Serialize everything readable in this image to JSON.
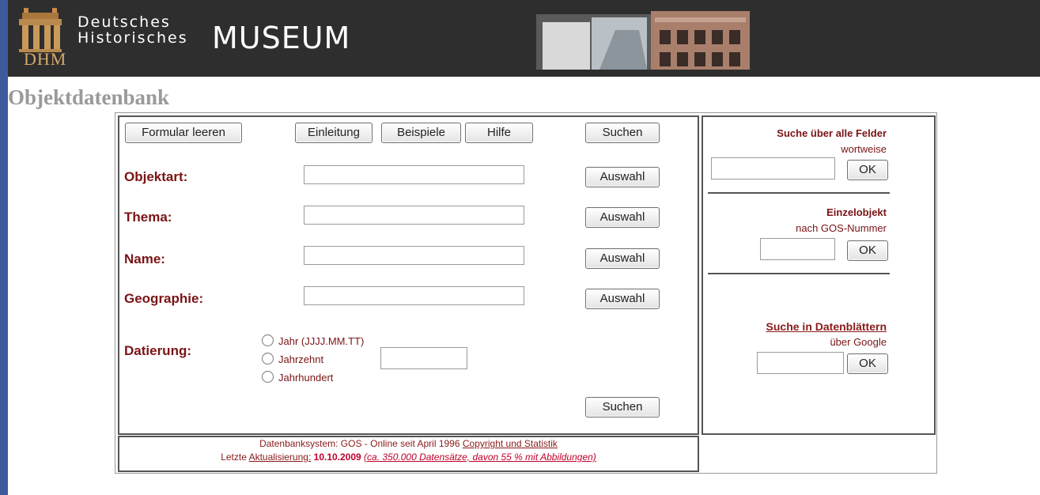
{
  "header": {
    "logo_text": "DHM",
    "brand_line1": "Deutsches",
    "brand_line2": "Historisches",
    "brand_big": "MUSEUM"
  },
  "page_title": "Objektdatenbank",
  "form": {
    "clear_label": "Formular leeren",
    "intro_label": "Einleitung",
    "examples_label": "Beispiele",
    "help_label": "Hilfe",
    "search_label": "Suchen",
    "fields": [
      {
        "label": "Objektart:",
        "select_label": "Auswahl",
        "value": ""
      },
      {
        "label": "Thema:",
        "select_label": "Auswahl",
        "value": ""
      },
      {
        "label": "Name:",
        "select_label": "Auswahl",
        "value": ""
      },
      {
        "label": "Geographie:",
        "select_label": "Auswahl",
        "value": ""
      }
    ],
    "dating": {
      "label": "Datierung:",
      "options": [
        "Jahr (JJJJ.MM.TT)",
        "Jahrzehnt",
        "Jahrhundert"
      ],
      "value": ""
    },
    "search_bottom_label": "Suchen"
  },
  "side": {
    "all_fields_title": "Suche über alle Felder",
    "all_fields_sub": "wortweise",
    "ok_label": "OK",
    "single_title": "Einzelobjekt",
    "single_sub": "nach GOS-Nummer",
    "sheets_title": "Suche in Datenblättern",
    "sheets_sub": "über Google"
  },
  "footer": {
    "line1_prefix": "Datenbanksystem: GOS - Online seit April 1996",
    "line1_link": "Copyright und Statistik",
    "line2_prefix": "Letzte",
    "line2_link": "Aktualisierung:",
    "line2_date": "10.10.2009",
    "line2_note": "(ca. 350.000 Datensätze, davon 55 % mit Abbildungen)"
  }
}
